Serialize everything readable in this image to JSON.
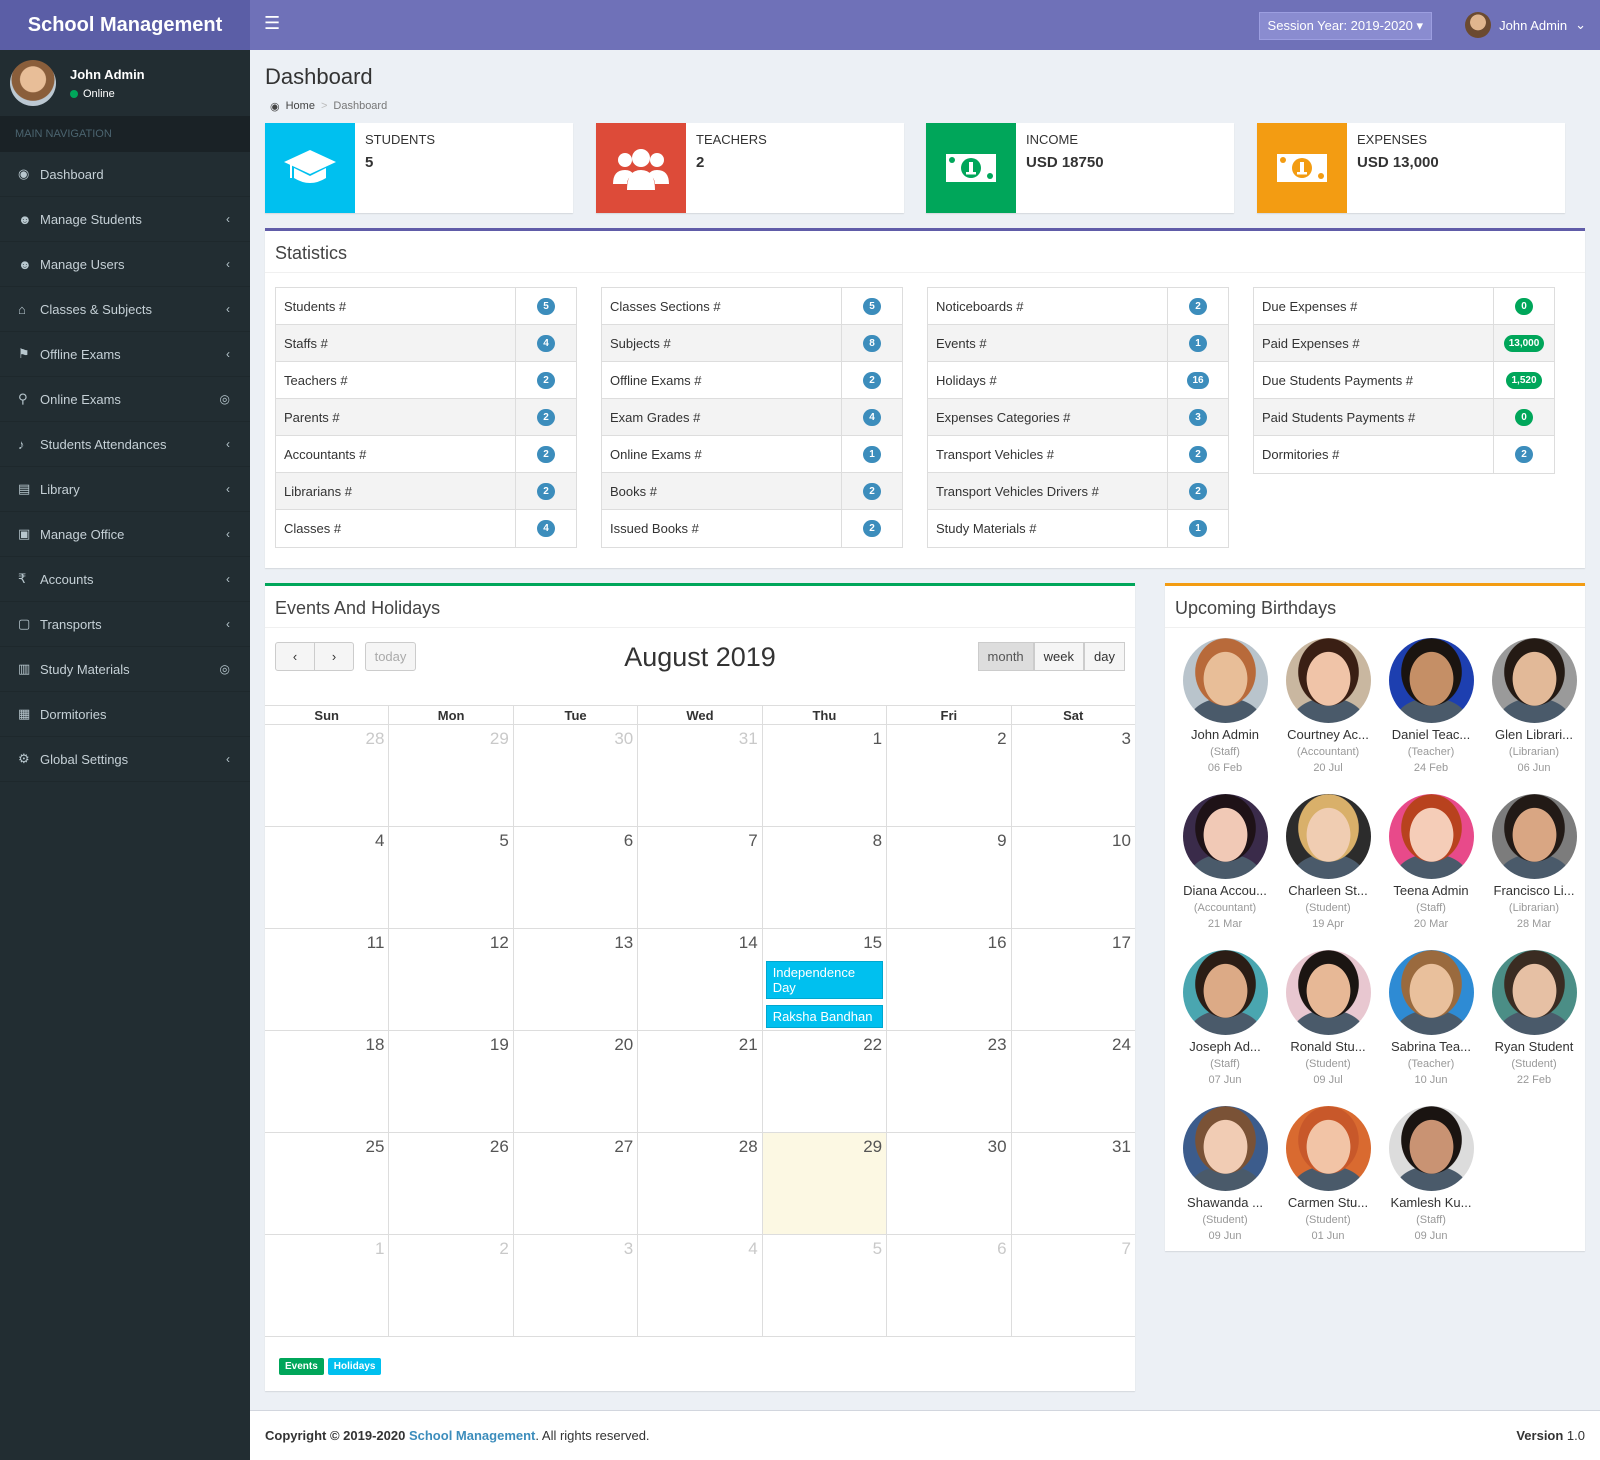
{
  "app": {
    "title": "School Management",
    "session": "Session Year: 2019-2020",
    "user": "John Admin"
  },
  "sidebar": {
    "user_name": "John Admin",
    "user_status": "Online",
    "nav_header": "MAIN NAVIGATION",
    "items": [
      {
        "label": "Dashboard",
        "icon": "dashboard-icon"
      },
      {
        "label": "Manage Students",
        "icon": "users-icon"
      },
      {
        "label": "Manage Users",
        "icon": "users-icon"
      },
      {
        "label": "Classes & Subjects",
        "icon": "bank-icon"
      },
      {
        "label": "Offline Exams",
        "icon": "graduation-cap-icon"
      },
      {
        "label": "Online Exams",
        "icon": "search-icon"
      },
      {
        "label": "Students Attendances",
        "icon": "bell-icon"
      },
      {
        "label": "Library",
        "icon": "book-icon"
      },
      {
        "label": "Manage Office",
        "icon": "briefcase-icon"
      },
      {
        "label": "Accounts",
        "icon": "rupee-icon"
      },
      {
        "label": "Transports",
        "icon": "bus-icon"
      },
      {
        "label": "Study Materials",
        "icon": "open-book-icon"
      },
      {
        "label": "Dormitories",
        "icon": "building-icon"
      },
      {
        "label": "Global Settings",
        "icon": "gears-icon"
      }
    ]
  },
  "page": {
    "title": "Dashboard",
    "breadcrumb_home": "Home",
    "breadcrumb_current": "Dashboard"
  },
  "info_boxes": [
    {
      "label": "STUDENTS",
      "value": "5",
      "color": "#00c0ef",
      "icon": "graduation-cap-icon"
    },
    {
      "label": "TEACHERS",
      "value": "2",
      "color": "#dd4b39",
      "icon": "users-icon"
    },
    {
      "label": "INCOME",
      "value": "USD 18750",
      "color": "#00a65a",
      "icon": "money-icon"
    },
    {
      "label": "EXPENSES",
      "value": "USD 13,000",
      "color": "#f39c12",
      "icon": "money-icon"
    }
  ],
  "statistics": {
    "title": "Statistics",
    "columns": [
      [
        {
          "k": "Students #",
          "v": "5"
        },
        {
          "k": "Staffs #",
          "v": "4"
        },
        {
          "k": "Teachers #",
          "v": "2"
        },
        {
          "k": "Parents #",
          "v": "2"
        },
        {
          "k": "Accountants #",
          "v": "2"
        },
        {
          "k": "Librarians #",
          "v": "2"
        },
        {
          "k": "Classes #",
          "v": "4"
        }
      ],
      [
        {
          "k": "Classes Sections #",
          "v": "5"
        },
        {
          "k": "Subjects #",
          "v": "8"
        },
        {
          "k": "Offline Exams #",
          "v": "2"
        },
        {
          "k": "Exam Grades #",
          "v": "4"
        },
        {
          "k": "Online Exams #",
          "v": "1"
        },
        {
          "k": "Books #",
          "v": "2"
        },
        {
          "k": "Issued Books #",
          "v": "2"
        }
      ],
      [
        {
          "k": "Noticeboards #",
          "v": "2"
        },
        {
          "k": "Events #",
          "v": "1"
        },
        {
          "k": "Holidays #",
          "v": "16"
        },
        {
          "k": "Expenses Categories #",
          "v": "3"
        },
        {
          "k": "Transport Vehicles #",
          "v": "2"
        },
        {
          "k": "Transport Vehicles Drivers #",
          "v": "2"
        },
        {
          "k": "Study Materials #",
          "v": "1"
        }
      ],
      [
        {
          "k": "Due Expenses #",
          "v": "0",
          "green": true
        },
        {
          "k": "Paid Expenses #",
          "v": "13,000",
          "green": true
        },
        {
          "k": "Due Students Payments #",
          "v": "1,520",
          "green": true
        },
        {
          "k": "Paid Students Payments #",
          "v": "0",
          "green": true
        },
        {
          "k": "Dormitories #",
          "v": "2"
        }
      ]
    ]
  },
  "calendar": {
    "title": "Events And Holidays",
    "month_title": "August 2019",
    "today_label": "today",
    "views": [
      "month",
      "week",
      "day"
    ],
    "active_view": "month",
    "days": [
      "Sun",
      "Mon",
      "Tue",
      "Wed",
      "Thu",
      "Fri",
      "Sat"
    ],
    "weeks": [
      [
        [
          28,
          1
        ],
        [
          29,
          1
        ],
        [
          30,
          1
        ],
        [
          31,
          1
        ],
        [
          1,
          0
        ],
        [
          2,
          0
        ],
        [
          3,
          0
        ]
      ],
      [
        [
          4,
          0
        ],
        [
          5,
          0
        ],
        [
          6,
          0
        ],
        [
          7,
          0
        ],
        [
          8,
          0
        ],
        [
          9,
          0
        ],
        [
          10,
          0
        ]
      ],
      [
        [
          11,
          0
        ],
        [
          12,
          0
        ],
        [
          13,
          0
        ],
        [
          14,
          0
        ],
        [
          15,
          0
        ],
        [
          16,
          0
        ],
        [
          17,
          0
        ]
      ],
      [
        [
          18,
          0
        ],
        [
          19,
          0
        ],
        [
          20,
          0
        ],
        [
          21,
          0
        ],
        [
          22,
          0
        ],
        [
          23,
          0
        ],
        [
          24,
          0
        ]
      ],
      [
        [
          25,
          0
        ],
        [
          26,
          0
        ],
        [
          27,
          0
        ],
        [
          28,
          0
        ],
        [
          29,
          0
        ],
        [
          30,
          0
        ],
        [
          31,
          0
        ]
      ],
      [
        [
          1,
          1
        ],
        [
          2,
          1
        ],
        [
          3,
          1
        ],
        [
          4,
          1
        ],
        [
          5,
          1
        ],
        [
          6,
          1
        ],
        [
          7,
          1
        ]
      ]
    ],
    "today": "29",
    "events": [
      {
        "day": "15",
        "label": "Independence Day"
      },
      {
        "day": "15",
        "label": "Raksha Bandhan"
      }
    ],
    "legend": [
      {
        "label": "Events",
        "color": "#00a65a"
      },
      {
        "label": "Holidays",
        "color": "#00c0ef"
      }
    ]
  },
  "birthdays": {
    "title": "Upcoming Birthdays",
    "people": [
      {
        "name": "John Admin",
        "role": "(Staff)",
        "date": "06 Feb",
        "skin": "#e8be98",
        "hair": "#b86a3a",
        "bg": "#b9c4cc"
      },
      {
        "name": "Courtney Ac...",
        "role": "(Accountant)",
        "date": "20 Jul",
        "skin": "#f0c4a8",
        "hair": "#3a1f14",
        "bg": "#c9b7a0"
      },
      {
        "name": "Daniel Teac...",
        "role": "(Teacher)",
        "date": "24 Feb",
        "skin": "#c58f66",
        "hair": "#1a1410",
        "bg": "#1d3fb0"
      },
      {
        "name": "Glen Librari...",
        "role": "(Librarian)",
        "date": "06 Jun",
        "skin": "#e2b998",
        "hair": "#241a14",
        "bg": "#9a9a9a"
      },
      {
        "name": "Diana Accou...",
        "role": "(Accountant)",
        "date": "21 Mar",
        "skin": "#f1c9b6",
        "hair": "#1e1217",
        "bg": "#3a2b4a"
      },
      {
        "name": "Charleen St...",
        "role": "(Student)",
        "date": "19 Apr",
        "skin": "#f0cdb2",
        "hair": "#d9b06a",
        "bg": "#2c2c2c"
      },
      {
        "name": "Teena Admin",
        "role": "(Staff)",
        "date": "20 Mar",
        "skin": "#f5cdb8",
        "hair": "#b8421e",
        "bg": "#e84a8a"
      },
      {
        "name": "Francisco Li...",
        "role": "(Librarian)",
        "date": "28 Mar",
        "skin": "#d9a683",
        "hair": "#221a16",
        "bg": "#7c7c7c"
      },
      {
        "name": "Joseph Ad...",
        "role": "(Staff)",
        "date": "07 Jun",
        "skin": "#dcaa86",
        "hair": "#2b1d15",
        "bg": "#4aa6b0"
      },
      {
        "name": "Ronald Stu...",
        "role": "(Student)",
        "date": "09 Jul",
        "skin": "#e7b896",
        "hair": "#1b1512",
        "bg": "#e8c7d0"
      },
      {
        "name": "Sabrina Tea...",
        "role": "(Teacher)",
        "date": "10 Jun",
        "skin": "#e9c09c",
        "hair": "#9a6a3e",
        "bg": "#2e8bd4"
      },
      {
        "name": "Ryan Student",
        "role": "(Student)",
        "date": "22 Feb",
        "skin": "#e6c0a4",
        "hair": "#3a2c22",
        "bg": "#4b8e86"
      },
      {
        "name": "Shawanda ...",
        "role": "(Student)",
        "date": "09 Jun",
        "skin": "#f1ccb4",
        "hair": "#7a5236",
        "bg": "#3c5c8c"
      },
      {
        "name": "Carmen Stu...",
        "role": "(Student)",
        "date": "01 Jun",
        "skin": "#f2c4a6",
        "hair": "#c8582a",
        "bg": "#d96a30"
      },
      {
        "name": "Kamlesh Ku...",
        "role": "(Staff)",
        "date": "09 Jun",
        "skin": "#c99373",
        "hair": "#1a1411",
        "bg": "#dcdcdc"
      }
    ]
  },
  "footer": {
    "prefix": "Copyright © 2019-2020 ",
    "brand": "School Management",
    "suffix": ". All rights reserved.",
    "version_label": "Version",
    "version": " 1.0"
  }
}
